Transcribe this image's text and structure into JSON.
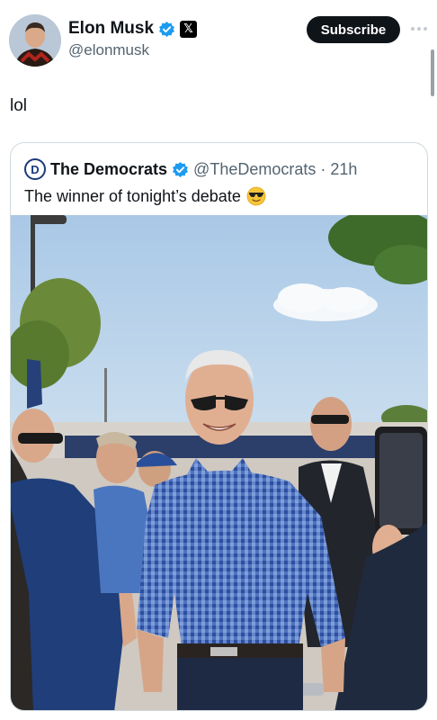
{
  "post": {
    "author_name": "Elon Musk",
    "author_handle": "@elonmusk",
    "subscribe_label": "Subscribe",
    "text": "lol",
    "badges": {
      "verified": "verified-icon",
      "affiliate": "x-badge-icon"
    }
  },
  "quote": {
    "author_name": "The Democrats",
    "author_handle": "@TheDemocrats",
    "separator": "·",
    "timestamp": "21h",
    "text": "The winner of tonight’s debate",
    "emoji": "sunglasses-emoji-icon",
    "logo_letter": "D",
    "media": "photo-of-smiling-man-in-sunglasses"
  },
  "colors": {
    "text": "#0f1419",
    "secondary": "#536471",
    "verified_blue": "#1d9bf0",
    "subscribe_bg": "#0f1419",
    "border": "#cfd9de"
  }
}
